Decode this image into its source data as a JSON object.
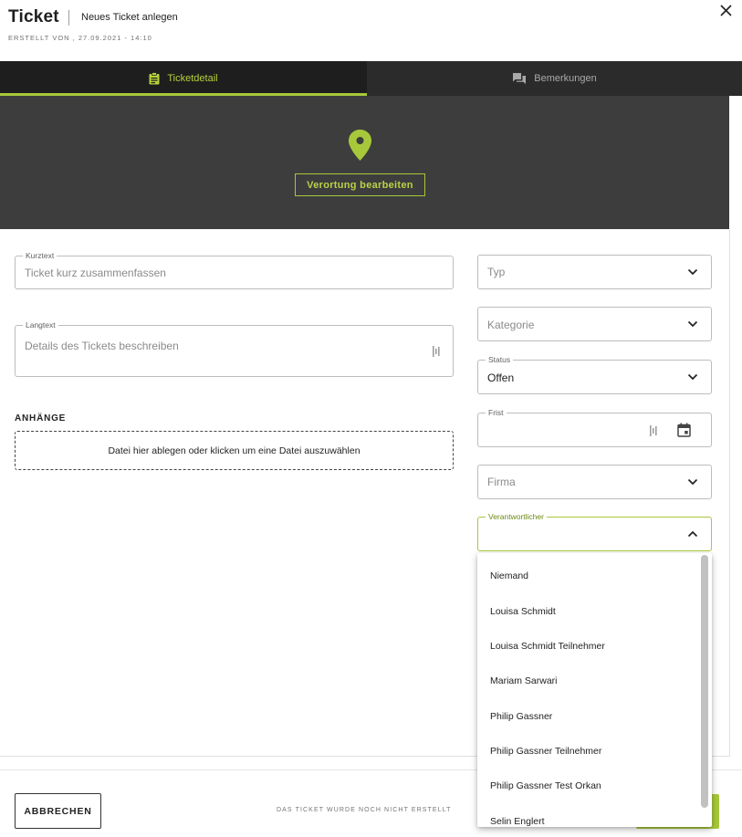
{
  "header": {
    "title": "Ticket",
    "subtitle": "Neues Ticket anlegen",
    "meta": "ERSTELLT VON , 27.09.2021 - 14:10"
  },
  "tabs": [
    {
      "label": "Ticketdetail",
      "icon": "clipboard-icon",
      "active": true
    },
    {
      "label": "Bemerkungen",
      "icon": "chat-icon",
      "active": false
    }
  ],
  "map": {
    "button_label": "Verortung bearbeiten"
  },
  "form": {
    "kurztext": {
      "label": "Kurztext",
      "placeholder": "Ticket kurz zusammenfassen"
    },
    "langtext": {
      "label": "Langtext",
      "placeholder": "Details des Tickets beschreiben"
    },
    "attachments": {
      "title": "ANHÄNGE",
      "dropzone_text": "Datei hier ablegen oder klicken um eine Datei auszuwählen"
    },
    "typ": {
      "placeholder": "Typ"
    },
    "kategorie": {
      "placeholder": "Kategorie"
    },
    "status": {
      "label": "Status",
      "value": "Offen"
    },
    "frist": {
      "label": "Frist"
    },
    "firma": {
      "placeholder": "Firma"
    },
    "verantwortlicher": {
      "label": "Verantwortlicher"
    }
  },
  "dropdown": {
    "options": [
      "Niemand",
      "Louisa Schmidt",
      "Louisa Schmidt Teilnehmer",
      "Mariam Sarwari",
      "Philip Gassner",
      "Philip Gassner Teilnehmer",
      "Philip Gassner Test Orkan",
      "Selin Englert"
    ]
  },
  "footer": {
    "cancel_label": "ABBRECHEN",
    "status_text": "DAS TICKET WURDE NOCH NICHT ERSTELLT"
  },
  "colors": {
    "accent": "#a7c83a",
    "dark": "#2b2b2b",
    "banner": "#3d3d3d"
  }
}
